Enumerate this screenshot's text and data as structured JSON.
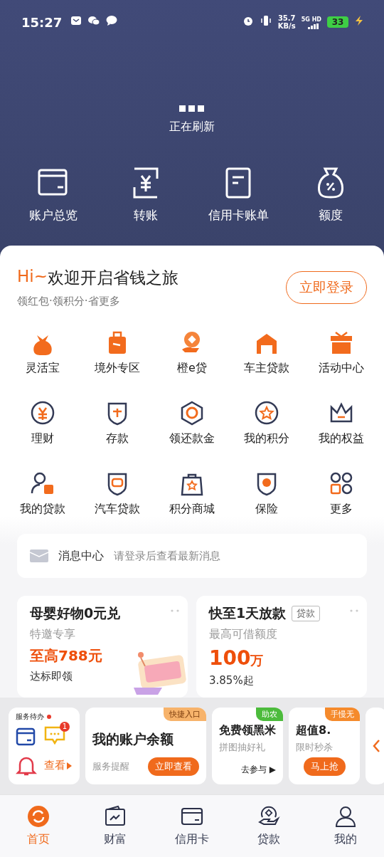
{
  "status_bar": {
    "time": "15:27",
    "speed": "35.7",
    "speed_unit": "KB/s",
    "network": "5G HD",
    "battery": "33"
  },
  "refresh": {
    "label": "正在刷新"
  },
  "quick_actions": [
    {
      "label": "账户总览"
    },
    {
      "label": "转账"
    },
    {
      "label": "信用卡账单"
    },
    {
      "label": "额度"
    }
  ],
  "welcome": {
    "prefix": "Hi~",
    "title": "欢迎开启省钱之旅",
    "subtitle": "领红包·领积分·省更多",
    "login_button": "立即登录"
  },
  "services": [
    {
      "label": "灵活宝"
    },
    {
      "label": "境外专区"
    },
    {
      "label": "橙e贷"
    },
    {
      "label": "车主贷款"
    },
    {
      "label": "活动中心"
    },
    {
      "label": "理财"
    },
    {
      "label": "存款"
    },
    {
      "label": "领还款金"
    },
    {
      "label": "我的积分"
    },
    {
      "label": "我的权益"
    },
    {
      "label": "我的贷款"
    },
    {
      "label": "汽车贷款"
    },
    {
      "label": "积分商城"
    },
    {
      "label": "保险"
    },
    {
      "label": "更多"
    }
  ],
  "message_center": {
    "title": "消息中心",
    "text": "请登录后查看最新消息"
  },
  "promo_cards": [
    {
      "title": "母婴好物0元兑",
      "subtitle": "特邀专享",
      "highlight": "至高788元",
      "footer": "达标即领"
    },
    {
      "title": "快至1天放款",
      "tag": "贷款",
      "subtitle": "最高可借额度",
      "highlight": "100",
      "highlight_unit": "万",
      "footer": "3.85%起"
    }
  ],
  "todo_panel": {
    "title": "服务待办",
    "badge": "1",
    "link": "查看"
  },
  "shortcut_cards": [
    {
      "tag": "快捷入口",
      "color": "#f7b36b",
      "title": "我的账户余额",
      "subtitle": "服务提醒",
      "action": "立即查看",
      "kind": "button"
    },
    {
      "tag": "助农",
      "color": "#4cbb3c",
      "title": "免费领黑米",
      "subtitle": "拼图抽好礼",
      "action": "去参与 ▶",
      "kind": "link"
    },
    {
      "tag": "手慢无",
      "color": "#f58a2c",
      "title": "超值8.",
      "subtitle": "限时秒杀",
      "action": "马上抢",
      "kind": "button"
    }
  ],
  "tabs": [
    {
      "label": "首页",
      "selected": true
    },
    {
      "label": "财富",
      "selected": false
    },
    {
      "label": "信用卡",
      "selected": false
    },
    {
      "label": "贷款",
      "selected": false
    },
    {
      "label": "我的",
      "selected": false
    }
  ]
}
